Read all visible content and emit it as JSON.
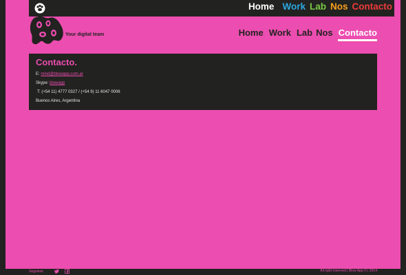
{
  "topbar": {
    "nav": [
      {
        "label": "Home",
        "color": "#ffffff"
      },
      {
        "label": "Work",
        "color": "#2BA8E0"
      },
      {
        "label": "Lab",
        "color": "#7AC943"
      },
      {
        "label": "Nos",
        "color": "#F7A01D"
      },
      {
        "label": "Contacto",
        "color": "#EE3B3B"
      }
    ]
  },
  "header": {
    "tagline": "Your digital team"
  },
  "mainnav": {
    "items": [
      "Home",
      "Work",
      "Lab",
      "Nos",
      "Contacto"
    ],
    "active": "Contacto"
  },
  "contact": {
    "title": "Contacto.",
    "email_label": "E: ",
    "email": "mind@blowapp.com.ar",
    "skype_label": "Skype: ",
    "skype": "blowapp",
    "phone": "T: (+54 11) 4777 0327 / (+54 9) 11 6047 0006",
    "address": "Buenos Aires, Argentina"
  },
  "footer": {
    "follow": "Seguinos",
    "copyright": "All right reserved | Blow App © | 2014"
  },
  "colors": {
    "accent": "#EC4DB0",
    "dark": "#222220"
  }
}
